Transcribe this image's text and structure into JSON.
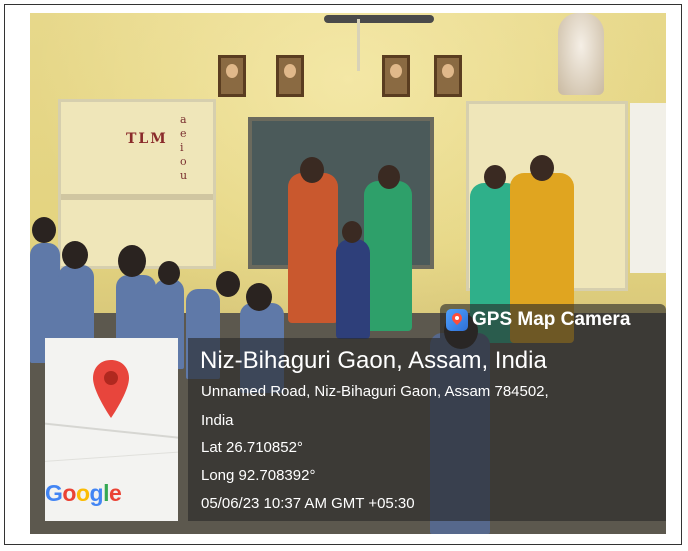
{
  "photo": {
    "classroom_sign": "TLM",
    "vowels": "a e i o u"
  },
  "overlay": {
    "app_name": "GPS Map Camera",
    "app_icon": "gps-map-camera-icon",
    "map_icon": "map-pin-icon",
    "map_brand": "Google",
    "place_title": "Niz-Bihaguri Gaon, Assam, India",
    "address_line1": "Unnamed Road, Niz-Bihaguri Gaon, Assam 784502,",
    "address_line2": "India",
    "latitude": "Lat 26.710852°",
    "longitude": "Long 92.708392°",
    "timestamp": "05/06/23 10:37 AM GMT +05:30"
  },
  "colors": {
    "pin": "#e8453c",
    "panel": "#282828"
  }
}
